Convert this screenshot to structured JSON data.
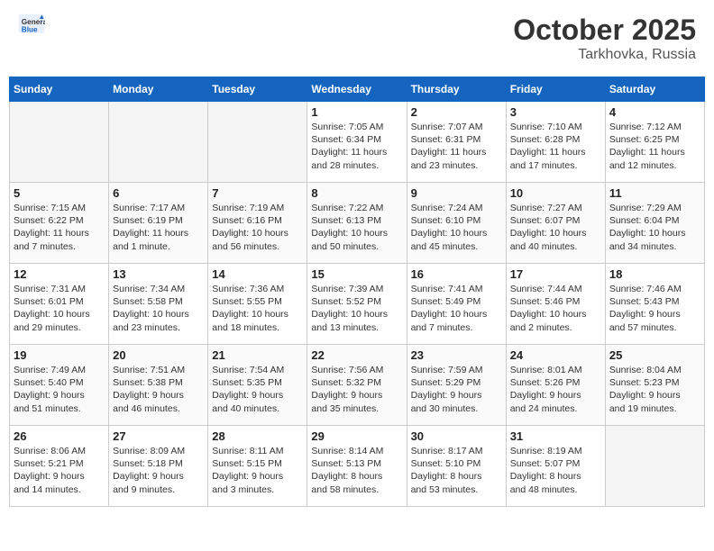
{
  "header": {
    "logo_general": "General",
    "logo_blue": "Blue",
    "month_year": "October 2025",
    "location": "Tarkhovka, Russia"
  },
  "weekdays": [
    "Sunday",
    "Monday",
    "Tuesday",
    "Wednesday",
    "Thursday",
    "Friday",
    "Saturday"
  ],
  "weeks": [
    [
      {
        "day": "",
        "info": ""
      },
      {
        "day": "",
        "info": ""
      },
      {
        "day": "",
        "info": ""
      },
      {
        "day": "1",
        "info": "Sunrise: 7:05 AM\nSunset: 6:34 PM\nDaylight: 11 hours\nand 28 minutes."
      },
      {
        "day": "2",
        "info": "Sunrise: 7:07 AM\nSunset: 6:31 PM\nDaylight: 11 hours\nand 23 minutes."
      },
      {
        "day": "3",
        "info": "Sunrise: 7:10 AM\nSunset: 6:28 PM\nDaylight: 11 hours\nand 17 minutes."
      },
      {
        "day": "4",
        "info": "Sunrise: 7:12 AM\nSunset: 6:25 PM\nDaylight: 11 hours\nand 12 minutes."
      }
    ],
    [
      {
        "day": "5",
        "info": "Sunrise: 7:15 AM\nSunset: 6:22 PM\nDaylight: 11 hours\nand 7 minutes."
      },
      {
        "day": "6",
        "info": "Sunrise: 7:17 AM\nSunset: 6:19 PM\nDaylight: 11 hours\nand 1 minute."
      },
      {
        "day": "7",
        "info": "Sunrise: 7:19 AM\nSunset: 6:16 PM\nDaylight: 10 hours\nand 56 minutes."
      },
      {
        "day": "8",
        "info": "Sunrise: 7:22 AM\nSunset: 6:13 PM\nDaylight: 10 hours\nand 50 minutes."
      },
      {
        "day": "9",
        "info": "Sunrise: 7:24 AM\nSunset: 6:10 PM\nDaylight: 10 hours\nand 45 minutes."
      },
      {
        "day": "10",
        "info": "Sunrise: 7:27 AM\nSunset: 6:07 PM\nDaylight: 10 hours\nand 40 minutes."
      },
      {
        "day": "11",
        "info": "Sunrise: 7:29 AM\nSunset: 6:04 PM\nDaylight: 10 hours\nand 34 minutes."
      }
    ],
    [
      {
        "day": "12",
        "info": "Sunrise: 7:31 AM\nSunset: 6:01 PM\nDaylight: 10 hours\nand 29 minutes."
      },
      {
        "day": "13",
        "info": "Sunrise: 7:34 AM\nSunset: 5:58 PM\nDaylight: 10 hours\nand 23 minutes."
      },
      {
        "day": "14",
        "info": "Sunrise: 7:36 AM\nSunset: 5:55 PM\nDaylight: 10 hours\nand 18 minutes."
      },
      {
        "day": "15",
        "info": "Sunrise: 7:39 AM\nSunset: 5:52 PM\nDaylight: 10 hours\nand 13 minutes."
      },
      {
        "day": "16",
        "info": "Sunrise: 7:41 AM\nSunset: 5:49 PM\nDaylight: 10 hours\nand 7 minutes."
      },
      {
        "day": "17",
        "info": "Sunrise: 7:44 AM\nSunset: 5:46 PM\nDaylight: 10 hours\nand 2 minutes."
      },
      {
        "day": "18",
        "info": "Sunrise: 7:46 AM\nSunset: 5:43 PM\nDaylight: 9 hours\nand 57 minutes."
      }
    ],
    [
      {
        "day": "19",
        "info": "Sunrise: 7:49 AM\nSunset: 5:40 PM\nDaylight: 9 hours\nand 51 minutes."
      },
      {
        "day": "20",
        "info": "Sunrise: 7:51 AM\nSunset: 5:38 PM\nDaylight: 9 hours\nand 46 minutes."
      },
      {
        "day": "21",
        "info": "Sunrise: 7:54 AM\nSunset: 5:35 PM\nDaylight: 9 hours\nand 40 minutes."
      },
      {
        "day": "22",
        "info": "Sunrise: 7:56 AM\nSunset: 5:32 PM\nDaylight: 9 hours\nand 35 minutes."
      },
      {
        "day": "23",
        "info": "Sunrise: 7:59 AM\nSunset: 5:29 PM\nDaylight: 9 hours\nand 30 minutes."
      },
      {
        "day": "24",
        "info": "Sunrise: 8:01 AM\nSunset: 5:26 PM\nDaylight: 9 hours\nand 24 minutes."
      },
      {
        "day": "25",
        "info": "Sunrise: 8:04 AM\nSunset: 5:23 PM\nDaylight: 9 hours\nand 19 minutes."
      }
    ],
    [
      {
        "day": "26",
        "info": "Sunrise: 8:06 AM\nSunset: 5:21 PM\nDaylight: 9 hours\nand 14 minutes."
      },
      {
        "day": "27",
        "info": "Sunrise: 8:09 AM\nSunset: 5:18 PM\nDaylight: 9 hours\nand 9 minutes."
      },
      {
        "day": "28",
        "info": "Sunrise: 8:11 AM\nSunset: 5:15 PM\nDaylight: 9 hours\nand 3 minutes."
      },
      {
        "day": "29",
        "info": "Sunrise: 8:14 AM\nSunset: 5:13 PM\nDaylight: 8 hours\nand 58 minutes."
      },
      {
        "day": "30",
        "info": "Sunrise: 8:17 AM\nSunset: 5:10 PM\nDaylight: 8 hours\nand 53 minutes."
      },
      {
        "day": "31",
        "info": "Sunrise: 8:19 AM\nSunset: 5:07 PM\nDaylight: 8 hours\nand 48 minutes."
      },
      {
        "day": "",
        "info": ""
      }
    ]
  ]
}
